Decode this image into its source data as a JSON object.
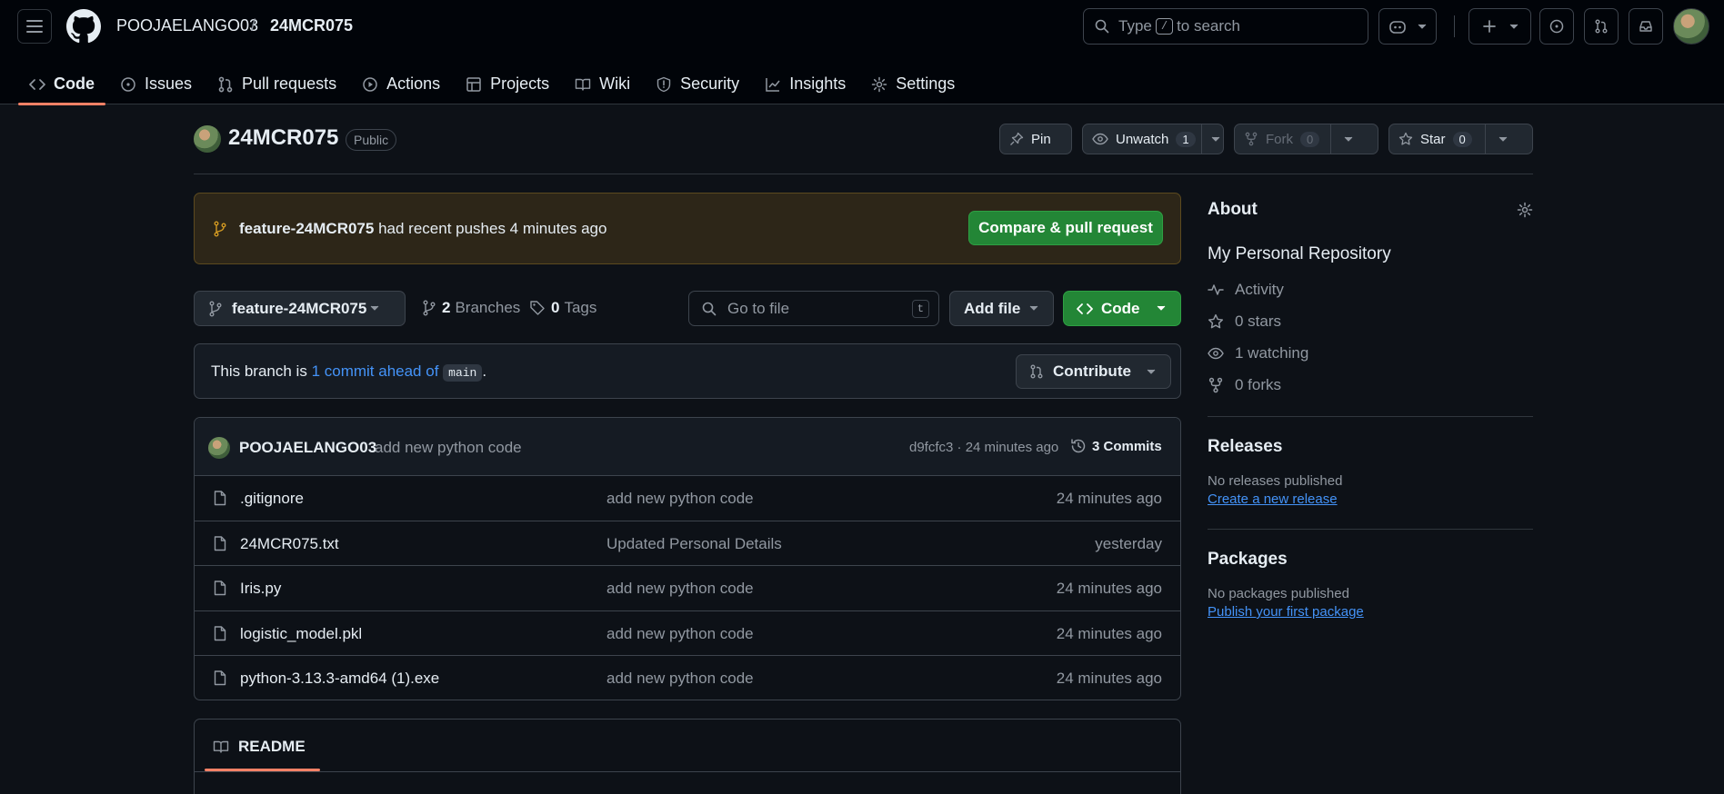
{
  "header": {
    "owner": "POOJAELANGO03",
    "separator": "/",
    "repo": "24MCR075",
    "search_prefix": "Type",
    "search_key": "/",
    "search_suffix": "to search"
  },
  "nav": {
    "tabs": [
      {
        "label": "Code",
        "icon": "code-icon",
        "active": true
      },
      {
        "label": "Issues",
        "icon": "issue-icon"
      },
      {
        "label": "Pull requests",
        "icon": "pull-request-icon"
      },
      {
        "label": "Actions",
        "icon": "play-icon"
      },
      {
        "label": "Projects",
        "icon": "table-icon"
      },
      {
        "label": "Wiki",
        "icon": "book-icon"
      },
      {
        "label": "Security",
        "icon": "shield-icon"
      },
      {
        "label": "Insights",
        "icon": "graph-icon"
      },
      {
        "label": "Settings",
        "icon": "gear-icon"
      }
    ]
  },
  "repo": {
    "name": "24MCR075",
    "visibility": "Public",
    "pin_label": "Pin",
    "unwatch_label": "Unwatch",
    "watch_count": "1",
    "fork_label": "Fork",
    "fork_count": "0",
    "star_label": "Star",
    "star_count": "0"
  },
  "banner": {
    "branch": "feature-24MCR075",
    "text": "had recent pushes 4 minutes ago",
    "button": "Compare & pull request"
  },
  "toolbar": {
    "branch": "feature-24MCR075",
    "branches_count": "2",
    "branches_label": "Branches",
    "tags_count": "0",
    "tags_label": "Tags",
    "go_to_file": "Go to file",
    "go_to_file_key": "t",
    "add_file": "Add file",
    "code": "Code"
  },
  "ahead": {
    "prefix": "This branch is",
    "link": "1 commit ahead of",
    "base": "main",
    "suffix": ".",
    "contribute": "Contribute"
  },
  "latest_commit": {
    "author": "POOJAELANGO03",
    "message": "add new python code",
    "hash_time": "d9fcfc3 · 24 minutes ago",
    "commits": "3 Commits"
  },
  "files": [
    {
      "name": ".gitignore",
      "message": "add new python code",
      "date": "24 minutes ago"
    },
    {
      "name": "24MCR075.txt",
      "message": "Updated Personal Details",
      "date": "yesterday"
    },
    {
      "name": "Iris.py",
      "message": "add new python code",
      "date": "24 minutes ago"
    },
    {
      "name": "logistic_model.pkl",
      "message": "add new python code",
      "date": "24 minutes ago"
    },
    {
      "name": "python-3.13.3-amd64 (1).exe",
      "message": "add new python code",
      "date": "24 minutes ago"
    }
  ],
  "readme": {
    "label": "README"
  },
  "about": {
    "title": "About",
    "description": "My Personal Repository",
    "activity": "Activity",
    "stars": "0 stars",
    "watching": "1 watching",
    "forks": "0 forks"
  },
  "releases": {
    "title": "Releases",
    "empty": "No releases published",
    "link": "Create a new release"
  },
  "packages": {
    "title": "Packages",
    "empty": "No packages published",
    "link": "Publish your first package"
  },
  "colors": {
    "background": "#0d1117",
    "header": "#010409",
    "accent_green": "#238636",
    "link_blue": "#4493f8",
    "tab_underline": "#f78166",
    "banner_bg": "#2d2618"
  }
}
